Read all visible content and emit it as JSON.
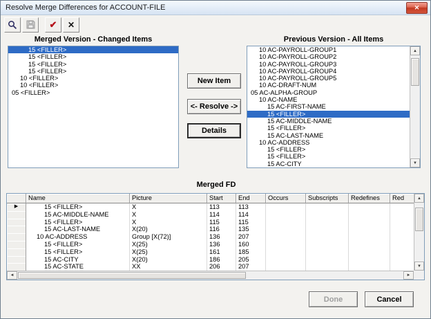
{
  "window": {
    "title": "Resolve Merge Differences for ACCOUNT-FILE",
    "close_glyph": "✕"
  },
  "toolbar": {
    "buttons": [
      {
        "name": "zoom",
        "icon": "magnifier-icon"
      },
      {
        "name": "save",
        "icon": "floppy-disk-icon",
        "disabled": true
      },
      {
        "name": "resolve-check",
        "icon": "check-icon",
        "glyph": "✔"
      },
      {
        "name": "delete",
        "icon": "x-icon",
        "glyph": "✕"
      }
    ]
  },
  "left_panel": {
    "title": "Merged Version - Changed Items",
    "items": [
      {
        "text": "15 <FILLER>",
        "indent": 3,
        "selected": true
      },
      {
        "text": "15 <FILLER>",
        "indent": 3
      },
      {
        "text": "15 <FILLER>",
        "indent": 3
      },
      {
        "text": "15 <FILLER>",
        "indent": 3
      },
      {
        "text": "10 <FILLER>",
        "indent": 2
      },
      {
        "text": "10 <FILLER>",
        "indent": 2
      },
      {
        "text": "05 <FILLER>",
        "indent": 1
      }
    ]
  },
  "right_panel": {
    "title": "Previous Version - All Items",
    "items": [
      {
        "text": "10 AC-PAYROLL-GROUP1",
        "indent": 2
      },
      {
        "text": "10 AC-PAYROLL-GROUP2",
        "indent": 2
      },
      {
        "text": "10 AC-PAYROLL-GROUP3",
        "indent": 2
      },
      {
        "text": "10 AC-PAYROLL-GROUP4",
        "indent": 2
      },
      {
        "text": "10 AC-PAYROLL-GROUP5",
        "indent": 2
      },
      {
        "text": "10 AC-DRAFT-NUM",
        "indent": 2
      },
      {
        "text": "05 AC-ALPHA-GROUP",
        "indent": 1
      },
      {
        "text": "10 AC-NAME",
        "indent": 2
      },
      {
        "text": "15 AC-FIRST-NAME",
        "indent": 3
      },
      {
        "text": "15 <FILLER>",
        "indent": 3,
        "selected": true
      },
      {
        "text": "15 AC-MIDDLE-NAME",
        "indent": 3
      },
      {
        "text": "15 <FILLER>",
        "indent": 3
      },
      {
        "text": "15 AC-LAST-NAME",
        "indent": 3
      },
      {
        "text": "10 AC-ADDRESS",
        "indent": 2
      },
      {
        "text": "15 <FILLER>",
        "indent": 3
      },
      {
        "text": "15 <FILLER>",
        "indent": 3
      },
      {
        "text": "15 AC-CITY",
        "indent": 3
      }
    ]
  },
  "actions": {
    "new_item": "New Item",
    "resolve": "<- Resolve ->",
    "details": "Details"
  },
  "grid": {
    "title": "Merged FD",
    "marker_glyph": "▶",
    "columns": [
      "Name",
      "Picture",
      "Start",
      "End",
      "Occurs",
      "Subscripts",
      "Redefines",
      "Red"
    ],
    "rows": [
      {
        "marker": true,
        "indent": 3,
        "name": "15 <FILLER>",
        "picture": "X",
        "start": "113",
        "end": "113",
        "occurs": "",
        "subscripts": "",
        "redefines": ""
      },
      {
        "indent": 3,
        "name": "15 AC-MIDDLE-NAME",
        "picture": "X",
        "start": "114",
        "end": "114",
        "occurs": "",
        "subscripts": "",
        "redefines": ""
      },
      {
        "indent": 3,
        "name": "15 <FILLER>",
        "picture": "X",
        "start": "115",
        "end": "115",
        "occurs": "",
        "subscripts": "",
        "redefines": ""
      },
      {
        "indent": 3,
        "name": "15 AC-LAST-NAME",
        "picture": "X(20)",
        "start": "116",
        "end": "135",
        "occurs": "",
        "subscripts": "",
        "redefines": ""
      },
      {
        "indent": 2,
        "name": "10 AC-ADDRESS",
        "picture": "Group [X(72)]",
        "start": "136",
        "end": "207",
        "occurs": "",
        "subscripts": "",
        "redefines": ""
      },
      {
        "indent": 3,
        "name": "15 <FILLER>",
        "picture": "X(25)",
        "start": "136",
        "end": "160",
        "occurs": "",
        "subscripts": "",
        "redefines": ""
      },
      {
        "indent": 3,
        "name": "15 <FILLER>",
        "picture": "X(25)",
        "start": "161",
        "end": "185",
        "occurs": "",
        "subscripts": "",
        "redefines": ""
      },
      {
        "indent": 3,
        "name": "15 AC-CITY",
        "picture": "X(20)",
        "start": "186",
        "end": "205",
        "occurs": "",
        "subscripts": "",
        "redefines": ""
      },
      {
        "indent": 3,
        "name": "15 AC-STATE",
        "picture": "XX",
        "start": "206",
        "end": "207",
        "occurs": "",
        "subscripts": "",
        "redefines": ""
      }
    ]
  },
  "scrollbar": {
    "up": "▲",
    "down": "▼",
    "left": "◄",
    "right": "►"
  },
  "footer": {
    "done": "Done",
    "cancel": "Cancel"
  }
}
